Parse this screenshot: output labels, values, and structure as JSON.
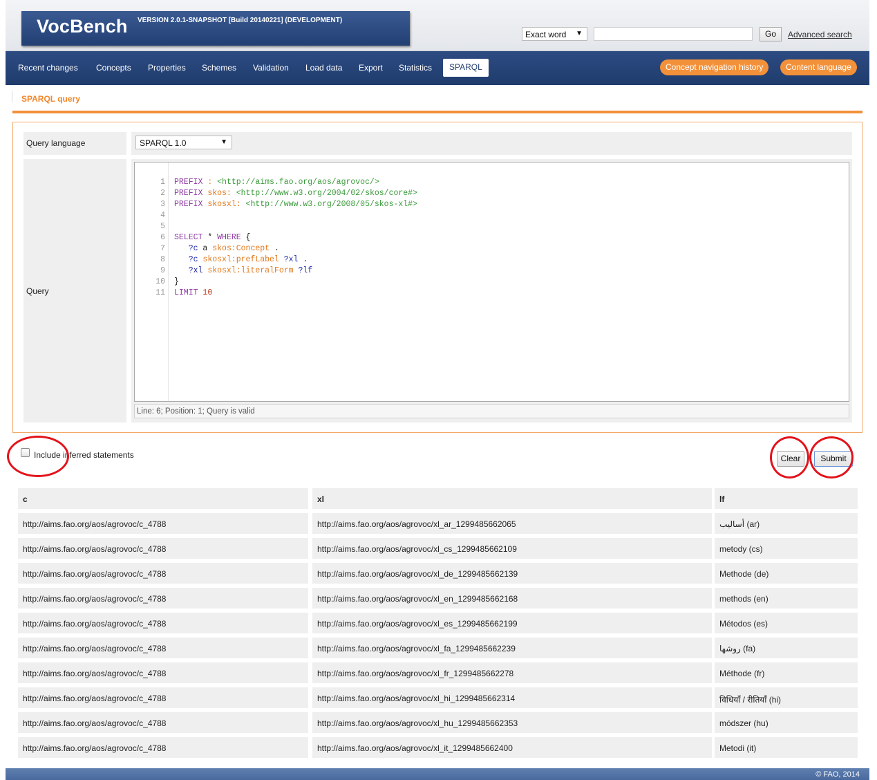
{
  "app": {
    "logo": "VocBench",
    "version": "VERSION 2.0.1-SNAPSHOT [Build 20140221] (DEVELOPMENT)"
  },
  "search": {
    "mode": "Exact word",
    "value": "",
    "go_label": "Go",
    "advanced_label": "Advanced search"
  },
  "nav": {
    "items": [
      "Recent changes",
      "Concepts",
      "Properties",
      "Schemes",
      "Validation",
      "Load data",
      "Export",
      "Statistics",
      "SPARQL"
    ],
    "active": "SPARQL",
    "right_buttons": [
      "Concept navigation history",
      "Content language"
    ]
  },
  "page": {
    "title": "SPARQL query"
  },
  "form": {
    "query_language_label": "Query language",
    "query_language_value": "SPARQL 1.0",
    "query_label": "Query",
    "status": "Line: 6; Position: 1; Query is valid"
  },
  "query_lines": [
    "PREFIX : <http://aims.fao.org/aos/agrovoc/>",
    "PREFIX skos: <http://www.w3.org/2004/02/skos/core#>",
    "PREFIX skosxl: <http://www.w3.org/2008/05/skos-xl#>",
    "",
    "",
    "SELECT * WHERE {",
    "   ?c a skos:Concept .",
    "   ?c skosxl:prefLabel ?xl .",
    "   ?xl skosxl:literalForm ?lf",
    "}",
    "LIMIT 10"
  ],
  "controls": {
    "include_inferred_label": "Include inferred statements",
    "include_inferred_checked": false,
    "clear_label": "Clear",
    "submit_label": "Submit"
  },
  "results": {
    "headers": [
      "c",
      "xl",
      "lf"
    ],
    "rows": [
      [
        "http://aims.fao.org/aos/agrovoc/c_4788",
        "http://aims.fao.org/aos/agrovoc/xl_ar_1299485662065",
        "أساليب (ar)"
      ],
      [
        "http://aims.fao.org/aos/agrovoc/c_4788",
        "http://aims.fao.org/aos/agrovoc/xl_cs_1299485662109",
        "metody (cs)"
      ],
      [
        "http://aims.fao.org/aos/agrovoc/c_4788",
        "http://aims.fao.org/aos/agrovoc/xl_de_1299485662139",
        "Methode (de)"
      ],
      [
        "http://aims.fao.org/aos/agrovoc/c_4788",
        "http://aims.fao.org/aos/agrovoc/xl_en_1299485662168",
        "methods (en)"
      ],
      [
        "http://aims.fao.org/aos/agrovoc/c_4788",
        "http://aims.fao.org/aos/agrovoc/xl_es_1299485662199",
        "Métodos (es)"
      ],
      [
        "http://aims.fao.org/aos/agrovoc/c_4788",
        "http://aims.fao.org/aos/agrovoc/xl_fa_1299485662239",
        "روشها (fa)"
      ],
      [
        "http://aims.fao.org/aos/agrovoc/c_4788",
        "http://aims.fao.org/aos/agrovoc/xl_fr_1299485662278",
        "Méthode (fr)"
      ],
      [
        "http://aims.fao.org/aos/agrovoc/c_4788",
        "http://aims.fao.org/aos/agrovoc/xl_hi_1299485662314",
        "विधियाँ / रीतियाँ (hi)"
      ],
      [
        "http://aims.fao.org/aos/agrovoc/c_4788",
        "http://aims.fao.org/aos/agrovoc/xl_hu_1299485662353",
        "módszer (hu)"
      ],
      [
        "http://aims.fao.org/aos/agrovoc/c_4788",
        "http://aims.fao.org/aos/agrovoc/xl_it_1299485662400",
        "Metodi (it)"
      ]
    ]
  },
  "footer": {
    "copyright": "© FAO, 2014"
  },
  "colors": {
    "accent": "#f2903b",
    "nav_bg": "#203c6d",
    "annotation": "#e3131b"
  }
}
